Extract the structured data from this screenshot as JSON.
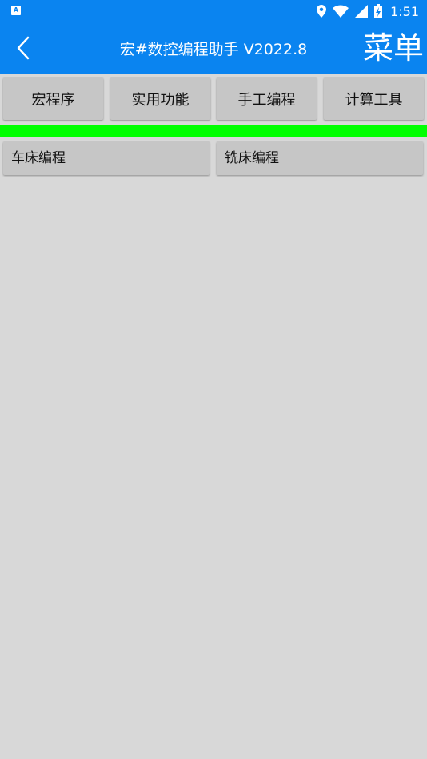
{
  "status_bar": {
    "app_badge": "A",
    "time": "1:51",
    "icons": [
      "location-icon",
      "wifi-icon",
      "signal-icon",
      "battery-charging-icon"
    ]
  },
  "app_bar": {
    "back_icon": "chevron-left-icon",
    "title": "宏#数控编程助手 V2022.8",
    "menu_label": "菜单"
  },
  "tabs": [
    {
      "label": "宏程序"
    },
    {
      "label": "实用功能"
    },
    {
      "label": "手工编程"
    },
    {
      "label": "计算工具"
    }
  ],
  "sub_buttons": [
    {
      "label": "车床编程"
    },
    {
      "label": "铣床编程"
    }
  ],
  "colors": {
    "primary": "#0a84f0",
    "accent_bar": "#00ff00",
    "background": "#d8d8d8",
    "button": "#c6c6c6"
  }
}
